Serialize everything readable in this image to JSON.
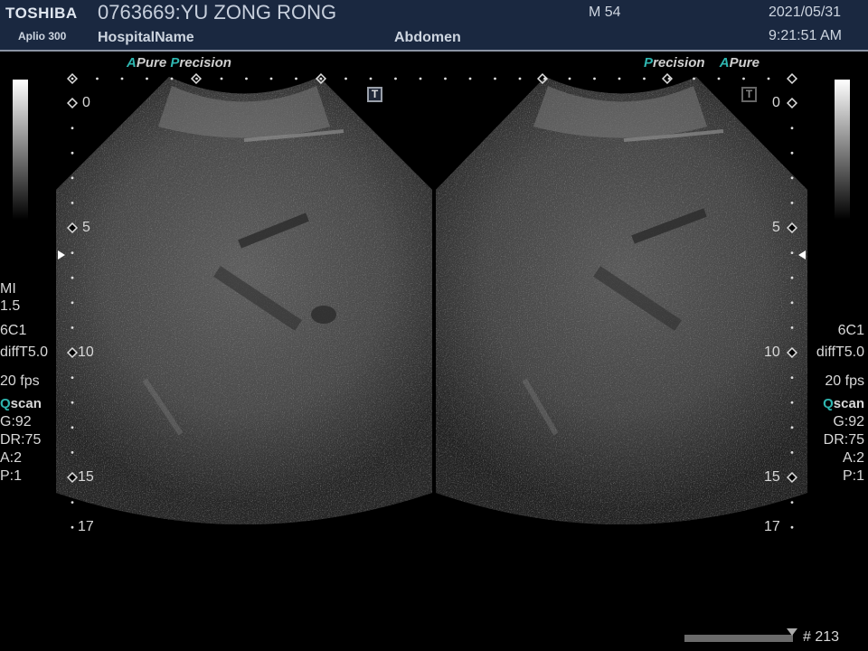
{
  "header": {
    "brand": "TOSHIBA",
    "model": "Aplio 300",
    "patient": "0763669:YU ZONG RONG",
    "hospital": "HospitalName",
    "exam": "Abdomen",
    "mode_status": "M 54",
    "date": "2021/05/31",
    "time": "9:21:51 AM"
  },
  "labels": {
    "left_a": "A",
    "left_pure": "Pure",
    "left_p": "P",
    "left_precision": "recision",
    "right_p": "P",
    "right_precision": "recision",
    "right_a": "A",
    "right_pure": "Pure",
    "t_active": "T",
    "t_inactive": "T"
  },
  "depth": {
    "left": [
      "0",
      "5",
      "10",
      "15",
      "17"
    ],
    "right": [
      "0",
      "5",
      "10",
      "15",
      "17"
    ]
  },
  "left_params": {
    "mi_label": "MI",
    "mi_value": "1.5",
    "probe": "6C1",
    "freq": "diffT5.0",
    "fps": "20 fps",
    "q": "Q",
    "scan": "scan",
    "gain": "G:92",
    "dr": "DR:75",
    "a": "A:2",
    "p": "P:1"
  },
  "right_params": {
    "probe": "6C1",
    "freq": "diffT5.0",
    "fps": "20 fps",
    "q": "Q",
    "scan": "scan",
    "gain": "G:92",
    "dr": "DR:75",
    "a": "A:2",
    "p": "P:1"
  },
  "footer": {
    "frame": "# 213"
  },
  "colors": {
    "header_bg": "#1a2840",
    "accent": "#2fb6b0"
  }
}
